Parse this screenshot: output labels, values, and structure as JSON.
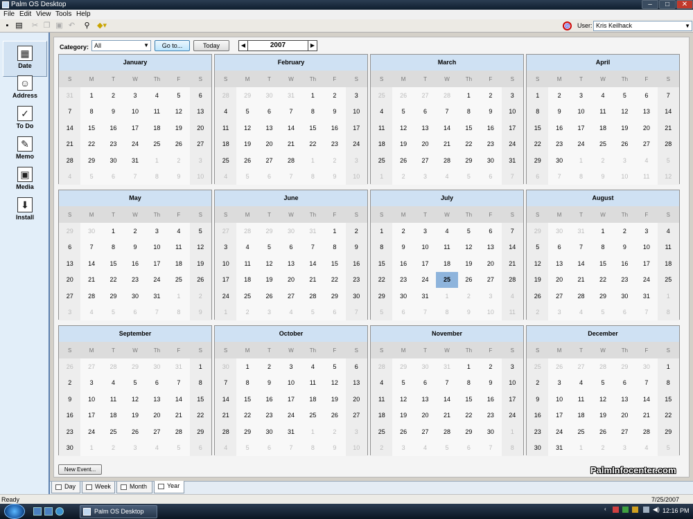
{
  "window": {
    "title": "Palm OS Desktop"
  },
  "menu": [
    "File",
    "Edit",
    "View",
    "Tools",
    "Help"
  ],
  "toolbar": {
    "icons": [
      "save-icon",
      "print-icon",
      "cut-icon",
      "copy-icon",
      "paste-icon",
      "undo-icon",
      "find-icon",
      "category-icon"
    ],
    "user_label": "User:",
    "user_value": "Kris Keilhack"
  },
  "sidebar": [
    {
      "label": "Date",
      "icon": "calendar-icon",
      "glyph": "▦"
    },
    {
      "label": "Address",
      "icon": "address-card-icon",
      "glyph": "☺"
    },
    {
      "label": "To Do",
      "icon": "todo-check-icon",
      "glyph": "✓"
    },
    {
      "label": "Memo",
      "icon": "memo-pad-icon",
      "glyph": "✎"
    },
    {
      "label": "Media",
      "icon": "media-film-icon",
      "glyph": "▣"
    },
    {
      "label": "Install",
      "icon": "install-icon",
      "glyph": "⬇"
    }
  ],
  "controls": {
    "category_label": "Category:",
    "category_value": "All",
    "goto_label": "Go to...",
    "today_label": "Today",
    "year": "2007",
    "new_event_label": "New Event..."
  },
  "weekdays": [
    "S",
    "M",
    "T",
    "W",
    "Th",
    "F",
    "S"
  ],
  "months": [
    {
      "name": "January",
      "start": 1,
      "days": 31,
      "prev_days": 31
    },
    {
      "name": "February",
      "start": 4,
      "days": 28,
      "prev_days": 31
    },
    {
      "name": "March",
      "start": 4,
      "days": 31,
      "prev_days": 28
    },
    {
      "name": "April",
      "start": 0,
      "days": 30,
      "prev_days": 31
    },
    {
      "name": "May",
      "start": 2,
      "days": 31,
      "prev_days": 30
    },
    {
      "name": "June",
      "start": 5,
      "days": 30,
      "prev_days": 31
    },
    {
      "name": "July",
      "start": 0,
      "days": 31,
      "prev_days": 30
    },
    {
      "name": "August",
      "start": 3,
      "days": 31,
      "prev_days": 31
    },
    {
      "name": "September",
      "start": 6,
      "days": 30,
      "prev_days": 31
    },
    {
      "name": "October",
      "start": 1,
      "days": 31,
      "prev_days": 30
    },
    {
      "name": "November",
      "start": 4,
      "days": 30,
      "prev_days": 31
    },
    {
      "name": "December",
      "start": 6,
      "days": 31,
      "prev_days": 30
    }
  ],
  "today": {
    "month": "July",
    "day": 25
  },
  "view_tabs": [
    "Day",
    "Week",
    "Month",
    "Year"
  ],
  "active_view": "Year",
  "status": {
    "text": "Ready",
    "date": "7/25/2007"
  },
  "taskbar": {
    "task_label": "Palm OS Desktop",
    "clock": "12:16 PM"
  },
  "watermark": "PalmInfocenter.com"
}
